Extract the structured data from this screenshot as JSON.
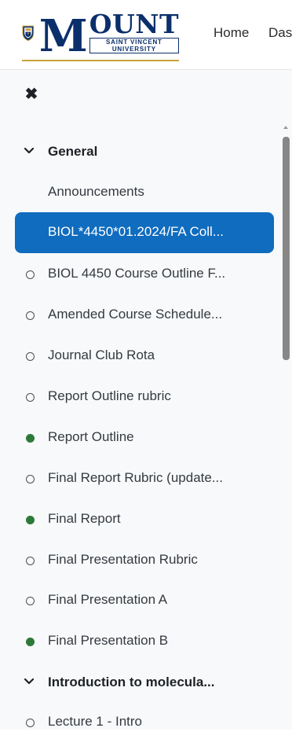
{
  "navbar": {
    "logo": {
      "big": "M",
      "ount": "OUNT",
      "line1": "SAINT VINCENT",
      "line2": "UNIVERSITY"
    },
    "links": {
      "home": "Home",
      "dashboard": "Das"
    }
  },
  "drawer": {
    "close_icon": "close-icon",
    "sections": [
      {
        "label": "General",
        "expanded": true
      },
      {
        "label": "Introduction to molecula...",
        "expanded": true
      }
    ],
    "items": [
      {
        "label": "Announcements",
        "status": "none"
      },
      {
        "label": "BIOL*4450*01.2024/FA Coll...",
        "status": "none",
        "active": true
      },
      {
        "label": "BIOL 4450 Course Outline F...",
        "status": "empty"
      },
      {
        "label": "Amended Course Schedule...",
        "status": "empty"
      },
      {
        "label": "Journal Club Rota",
        "status": "empty"
      },
      {
        "label": "Report Outline rubric",
        "status": "empty"
      },
      {
        "label": "Report Outline",
        "status": "done"
      },
      {
        "label": "Final Report Rubric (update...",
        "status": "empty"
      },
      {
        "label": "Final Report",
        "status": "done"
      },
      {
        "label": "Final Presentation Rubric",
        "status": "empty"
      },
      {
        "label": "Final Presentation A",
        "status": "empty"
      },
      {
        "label": "Final Presentation B",
        "status": "done"
      },
      {
        "label": "Lecture 1 - Intro",
        "status": "empty"
      }
    ]
  },
  "colors": {
    "active_bg": "#0f6cbf",
    "complete": "#2c7a3a",
    "brand_navy": "#0b2f6b",
    "brand_gold": "#c9a23c"
  }
}
